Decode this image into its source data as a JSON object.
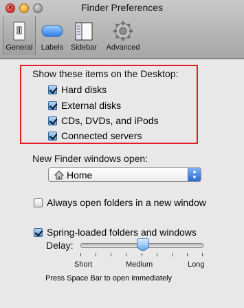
{
  "window": {
    "title": "Finder Preferences"
  },
  "toolbar": {
    "tabs": [
      {
        "label": "General",
        "icon": "general-icon",
        "active": true
      },
      {
        "label": "Labels",
        "icon": "labels-icon",
        "active": false
      },
      {
        "label": "Sidebar",
        "icon": "sidebar-icon",
        "active": false
      },
      {
        "label": "Advanced",
        "icon": "gear-icon",
        "active": false
      }
    ]
  },
  "desktop": {
    "heading": "Show these items on the Desktop:",
    "items": [
      {
        "label": "Hard disks",
        "checked": true
      },
      {
        "label": "External disks",
        "checked": true
      },
      {
        "label": "CDs, DVDs, and iPods",
        "checked": true
      },
      {
        "label": "Connected servers",
        "checked": true
      }
    ]
  },
  "new_window": {
    "label": "New Finder windows open:",
    "value": "Home"
  },
  "always_open": {
    "label": "Always open folders in a new window",
    "checked": false
  },
  "spring_loaded": {
    "label": "Spring-loaded folders and windows",
    "checked": true,
    "delay_label": "Delay:",
    "delay_setting": "Medium",
    "ticks": [
      "Short",
      "Medium",
      "Long"
    ],
    "note": "Press Space Bar to open immediately"
  },
  "colors": {
    "highlight_box": "#e21b25",
    "accent": "#2769cf"
  }
}
